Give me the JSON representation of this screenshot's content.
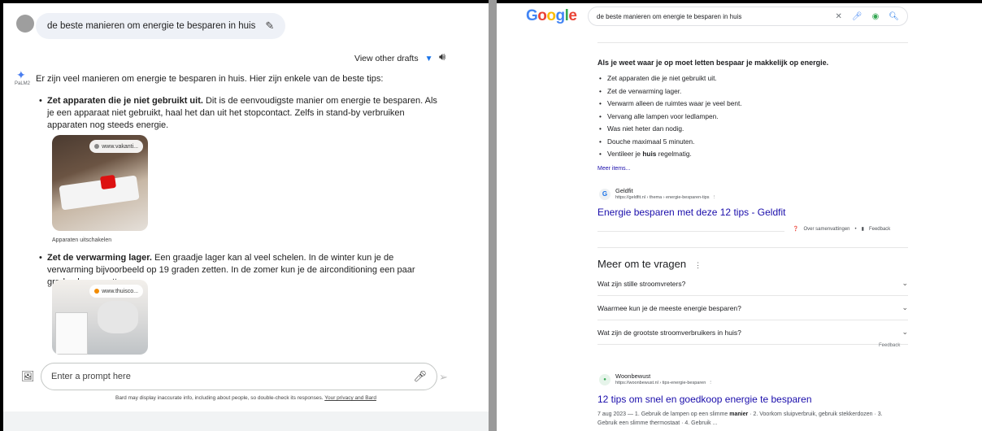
{
  "bard": {
    "query": "de beste manieren om energie te besparen in huis",
    "view_drafts": "View other drafts",
    "model_label": "PaLM2",
    "intro": "Er zijn veel manieren om energie te besparen in huis. Hier zijn enkele van de beste tips:",
    "tips": [
      {
        "bold": "Zet apparaten die je niet gebruikt uit.",
        "text": " Dit is de eenvoudigste manier om energie te besparen. Als je een apparaat niet gebruikt, haal het dan uit het stopcontact. Zelfs in stand-by verbruiken apparaten nog steeds energie."
      },
      {
        "bold": "Zet de verwarming lager.",
        "text": " Een graadje lager kan al veel schelen. In de winter kun je de verwarming bijvoorbeeld op 19 graden zetten. In de zomer kun je de airconditioning een paar graden hoger zetten."
      }
    ],
    "image1": {
      "source": "www.vakanti...",
      "caption": "Apparaten uitschakelen"
    },
    "image2": {
      "source": "www.thuisco..."
    },
    "prompt_placeholder": "Enter a prompt here",
    "disclaimer": "Bard may display inaccurate info, including about people, so double-check its responses.",
    "disclaimer_link": "Your privacy and Bard"
  },
  "google": {
    "logo": [
      "G",
      "o",
      "o",
      "g",
      "l",
      "e"
    ],
    "query": "de beste manieren om energie te besparen in huis",
    "snippet_title": "Als je weet waar je op moet letten bespaar je makkelijk op energie.",
    "snippet_items": [
      "Zet apparaten die je niet gebruikt uit.",
      "Zet de verwarming lager.",
      "Verwarm alleen de ruimtes waar je veel bent.",
      "Vervang alle lampen voor ledlampen.",
      "Was niet heter dan nodig.",
      "Douche maximaal 5 minuten.",
      "Ventileer je huis regelmatig."
    ],
    "meer_items": "Meer items...",
    "result1": {
      "site": "Geldfit",
      "url": "https://geldfit.nl › thema › energie-besparen-tips",
      "title": "Energie besparen met deze 12 tips - Geldfit"
    },
    "over_samenvattingen": "Over samenvattingen",
    "feedback": "Feedback",
    "paa_title": "Meer om te vragen",
    "paa": [
      "Wat zijn stille stroomvreters?",
      "Waarmee kun je de meeste energie besparen?",
      "Wat zijn de grootste stroomverbruikers in huis?"
    ],
    "result2": {
      "site": "Woonbewust",
      "url": "https://woonbewust.nl › tips-energie-besparen",
      "title": "12 tips om snel en goedkoop energie te besparen",
      "date": "7 aug 2023 —",
      "snippet_1": " 1. Gebruik de lampen op een slimme ",
      "snippet_bold": "manier",
      "snippet_2": " · 2. Voorkom sluipverbruik, gebruik stekkerdozen · 3. Gebruik een slimme thermostaat · 4. Gebruik ..."
    }
  }
}
